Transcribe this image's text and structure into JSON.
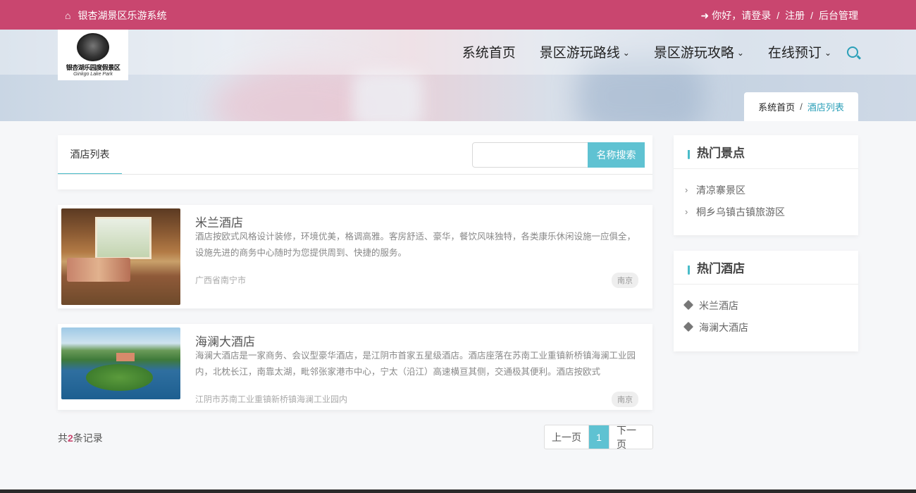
{
  "topbar": {
    "site_name": "银杏湖景区乐游系统",
    "greeting": "你好，请登录",
    "register": "注册",
    "admin": "后台管理",
    "sep": "/"
  },
  "logo": {
    "name": "银杏湖乐园度假景区",
    "subtitle": "Ginkgo Lake Park"
  },
  "nav": {
    "items": [
      {
        "label": "系统首页",
        "has_dropdown": false
      },
      {
        "label": "景区游玩路线",
        "has_dropdown": true
      },
      {
        "label": "景区游玩攻略",
        "has_dropdown": true
      },
      {
        "label": "在线预订",
        "has_dropdown": true
      }
    ]
  },
  "breadcrumb": {
    "home": "系统首页",
    "sep": "/",
    "current": "酒店列表"
  },
  "list": {
    "tab_label": "酒店列表",
    "search_placeholder": "",
    "search_button": "名称搜索",
    "hotels": [
      {
        "name": "米兰酒店",
        "description": "酒店按欧式风格设计装修，环境优美，格调高雅。客房舒适、豪华，餐饮风味独特，各类康乐休闲设施一应俱全，设施先进的商务中心随时为您提供周到、快捷的服务。",
        "address": "广西省南宁市",
        "city": "南京"
      },
      {
        "name": "海澜大酒店",
        "description": "海澜大酒店是一家商务、会议型豪华酒店，是江阴市首家五星级酒店。酒店座落在苏南工业重镇新桥镇海澜工业园内，北枕长江，南靠太湖，毗邻张家港市中心，宁太（沿江）高速横亘其侧，交通极其便利。酒店按欧式",
        "address": "江阴市苏南工业重镇新桥镇海澜工业园内",
        "city": "南京"
      }
    ],
    "count_prefix": "共",
    "count_value": "2",
    "count_suffix": "条记录"
  },
  "pager": {
    "prev": "上一页",
    "current": "1",
    "next": "下一页"
  },
  "sidebar": {
    "scenic": {
      "title": "热门景点",
      "items": [
        "清凉寨景区",
        "桐乡乌镇古镇旅游区"
      ]
    },
    "hotels": {
      "title": "热门酒店",
      "items": [
        "米兰酒店",
        "海澜大酒店"
      ]
    }
  },
  "colors": {
    "topbar": "#c9466f",
    "accent": "#49bcc9",
    "button": "#5fc2d2"
  }
}
